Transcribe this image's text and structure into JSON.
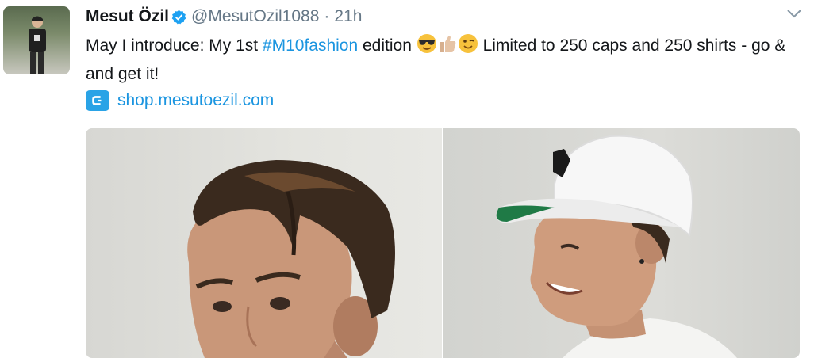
{
  "tweet": {
    "display_name": "Mesut Özil",
    "handle": "@MesutOzil1088",
    "separator": "·",
    "time": "21h",
    "text_before": "May I introduce: My 1st ",
    "hashtag": "#M10fashion",
    "text_after_hashtag": " edition ",
    "text_after_emoji": " Limited to 250 caps and 250 shirts - go & and get it!",
    "emojis": [
      "sunglasses-face-emoji",
      "thumbs-up-emoji",
      "winking-face-emoji"
    ],
    "link": "shop.mesutoezil.com",
    "link_icon": "shop-link-icon",
    "verified_icon": "verified-badge-icon",
    "menu_icon": "chevron-down-icon"
  },
  "colors": {
    "link": "#1b95e0",
    "muted": "#657786",
    "text": "#14171a",
    "verified": "#1da1f2"
  }
}
